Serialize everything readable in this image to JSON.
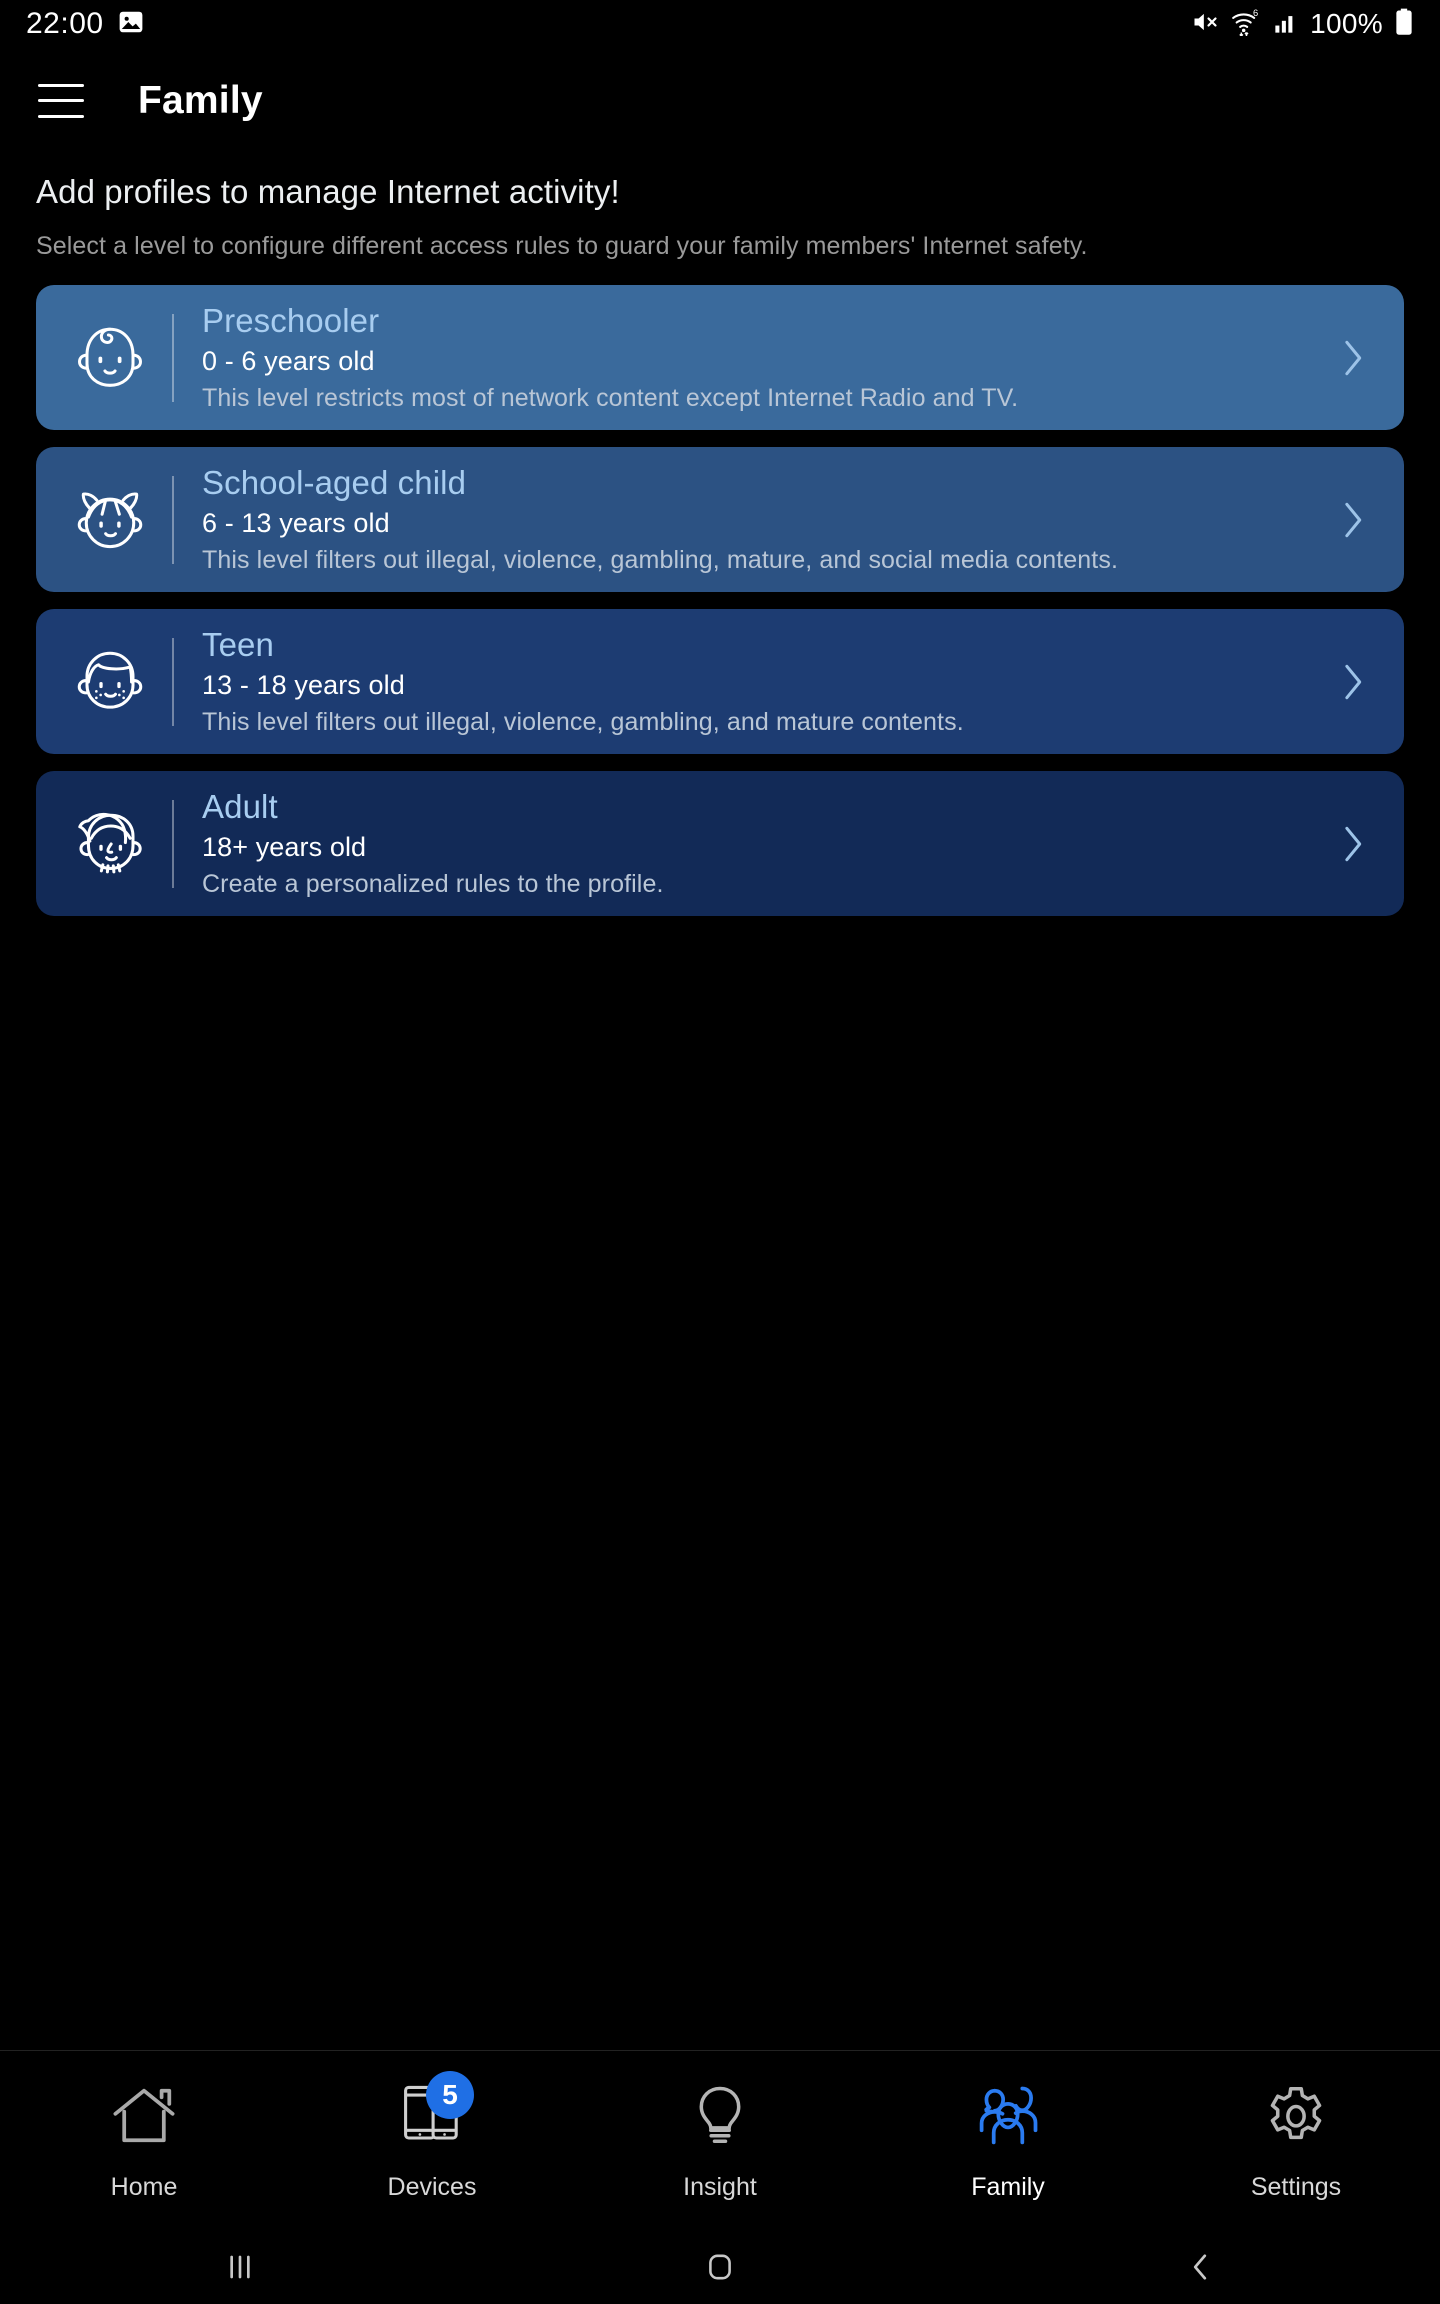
{
  "status_bar": {
    "time": "22:00",
    "battery_text": "100%",
    "icons": [
      "screenshot-image-icon",
      "mute-icon",
      "wifi6-icon",
      "signal-icon",
      "battery-icon"
    ]
  },
  "app_bar": {
    "menu_icon": "hamburger-menu-icon",
    "title": "Family"
  },
  "intro": {
    "title": "Add profiles to manage Internet activity!",
    "subtitle": "Select a level to configure different access rules to guard your family members' Internet safety."
  },
  "profiles": [
    {
      "title": "Preschooler",
      "age": "0 - 6 years old",
      "description": "This level restricts most of network content except Internet Radio and TV.",
      "icon": "baby-face-icon",
      "bg": "#3a6a9c"
    },
    {
      "title": "School-aged child",
      "age": "6 - 13 years old",
      "description": "This level filters out illegal, violence, gambling, mature, and social media contents.",
      "icon": "girl-face-icon",
      "bg": "#2c5283"
    },
    {
      "title": "Teen",
      "age": "13 - 18 years old",
      "description": "This level filters out illegal, violence, gambling, and mature contents.",
      "icon": "teen-face-icon",
      "bg": "#1d3c72"
    },
    {
      "title": "Adult",
      "age": "18+ years old",
      "description": "Create a personalized rules to the profile.",
      "icon": "adult-face-icon",
      "bg": "#122a57"
    }
  ],
  "bottom_nav": {
    "active": "Family",
    "accent": "#2a7bf0",
    "items": [
      {
        "label": "Home",
        "icon": "house-icon",
        "badge": ""
      },
      {
        "label": "Devices",
        "icon": "devices-icon",
        "badge": "5"
      },
      {
        "label": "Insight",
        "icon": "lightbulb-icon",
        "badge": ""
      },
      {
        "label": "Family",
        "icon": "people-icon",
        "badge": ""
      },
      {
        "label": "Settings",
        "icon": "gear-icon",
        "badge": ""
      }
    ]
  },
  "system_nav": {
    "recents": "recents-icon",
    "home": "home-square-icon",
    "back": "back-chevron-icon"
  }
}
